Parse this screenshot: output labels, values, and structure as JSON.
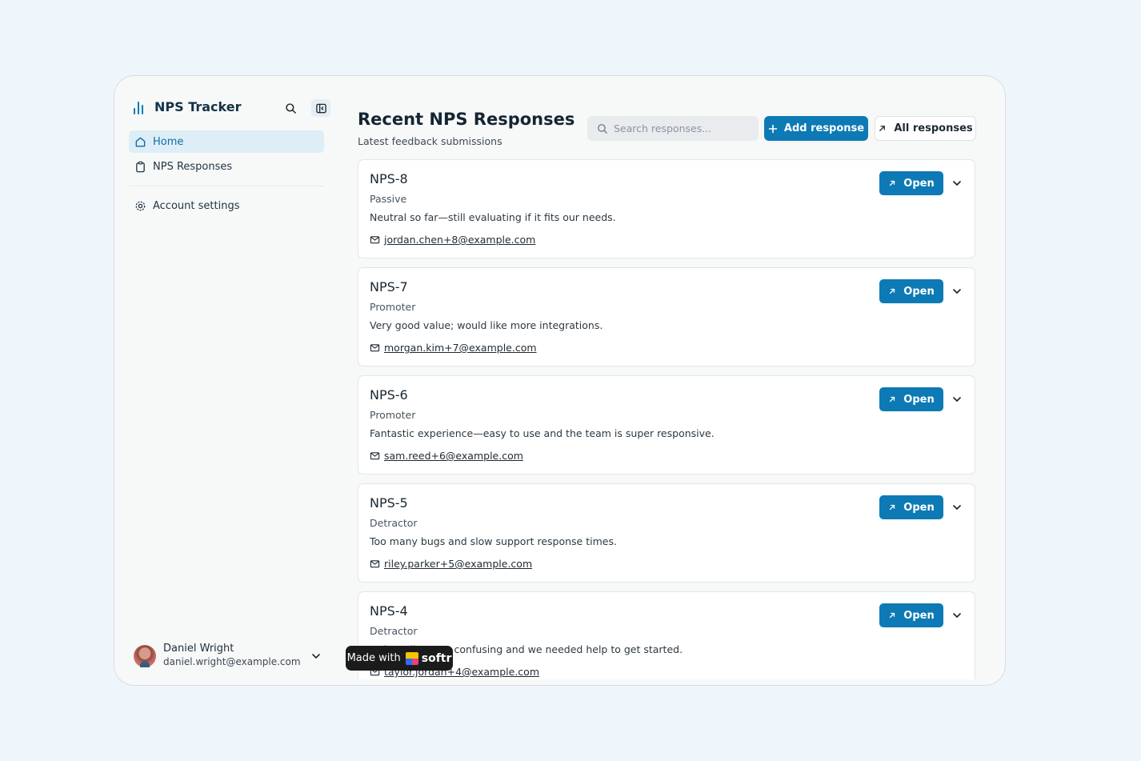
{
  "app": {
    "title": "NPS Tracker"
  },
  "sidebar": {
    "nav": [
      {
        "label": "Home",
        "icon": "home-icon",
        "active": true
      },
      {
        "label": "NPS Responses",
        "icon": "clipboard-icon",
        "active": false
      }
    ],
    "settings_label": "Account settings",
    "user": {
      "name": "Daniel Wright",
      "email": "daniel.wright@example.com"
    }
  },
  "main": {
    "title": "Recent NPS Responses",
    "subtitle": "Latest feedback submissions",
    "search_placeholder": "Search responses...",
    "add_label": "Add response",
    "all_label": "All responses",
    "open_label": "Open",
    "cards": [
      {
        "id": "NPS-8",
        "category": "Passive",
        "comment": "Neutral so far—still evaluating if it fits our needs.",
        "email": "jordan.chen+8@example.com"
      },
      {
        "id": "NPS-7",
        "category": "Promoter",
        "comment": "Very good value; would like more integrations.",
        "email": "morgan.kim+7@example.com"
      },
      {
        "id": "NPS-6",
        "category": "Promoter",
        "comment": "Fantastic experience—easy to use and the team is super responsive.",
        "email": "sam.reed+6@example.com"
      },
      {
        "id": "NPS-5",
        "category": "Detractor",
        "comment": "Too many bugs and slow support response times.",
        "email": "riley.parker+5@example.com"
      },
      {
        "id": "NPS-4",
        "category": "Detractor",
        "comment": "Onboarding was confusing and we needed help to get started.",
        "email": "taylor.jordan+4@example.com"
      }
    ]
  },
  "badge": {
    "prefix": "Made with",
    "brand": "softr"
  },
  "colors": {
    "accent": "#0d7ab5",
    "background": "#eef5fb"
  }
}
